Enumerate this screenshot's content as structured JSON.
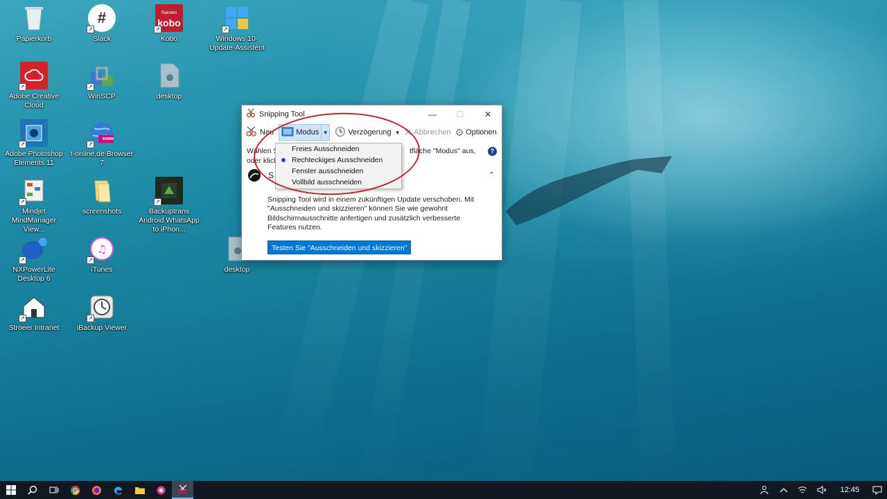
{
  "desktop": {
    "icons": [
      {
        "label": "Papierkorb",
        "icon": "recycle-bin-icon"
      },
      {
        "label": "Slack",
        "icon": "slack-icon"
      },
      {
        "label": "Kobo",
        "icon": "kobo-icon",
        "badge_text": "kobo",
        "badge_small": "Rakuten"
      },
      {
        "label": "Windows 10-Update-Assistent",
        "icon": "windows-logo-icon"
      },
      {
        "label": "Adobe Creative Cloud",
        "icon": "creative-cloud-icon"
      },
      {
        "label": "WinSCP",
        "icon": "winscp-icon"
      },
      {
        "label": "desktop",
        "icon": "file-icon"
      },
      {
        "label": "Adobe Photoshop Elements 11",
        "icon": "photoshop-elements-icon"
      },
      {
        "label": "t-online.de Browser 7",
        "icon": "globe-icon",
        "badge_text": "www"
      },
      {
        "label": "Mindjet MindManager View...",
        "icon": "mindmanager-icon"
      },
      {
        "label": "screenshots",
        "icon": "folder-icon"
      },
      {
        "label": "Backuptrans Android WhatsApp to iPhon...",
        "icon": "backuptrans-icon"
      },
      {
        "label": "NXPowerLite Desktop 6",
        "icon": "nxpowerlite-icon"
      },
      {
        "label": "iTunes",
        "icon": "itunes-icon"
      },
      {
        "label": "desktop",
        "icon": "file-icon"
      },
      {
        "label": "Stroeer Intranet",
        "icon": "home-icon"
      },
      {
        "label": "iBackup Viewer",
        "icon": "clock-icon"
      }
    ]
  },
  "window": {
    "title": "Snipping Tool",
    "controls": {
      "minimize": "—",
      "maximize": "☐",
      "close": "✕"
    },
    "toolbar": {
      "new_label": "Neu",
      "mode_label": "Modus",
      "delay_label": "Verzögerung",
      "cancel_label": "Abbrechen",
      "options_label": "Optionen"
    },
    "info": {
      "line1_start": "Wählen S",
      "line1_end": "tfläche \"Modus\" aus,",
      "line2_start": "oder klick",
      "help": "?"
    },
    "notice": {
      "title_initial": "S",
      "collapse": "⌃",
      "body": "Snipping Tool wird in einem zukünftigen Update verschoben. Mit \"Ausschneiden und skizzieren\" können Sie wie gewohnt Bildschirmausschnitte anfertigen und zusätzlich verbesserte Features nutzen.",
      "button_label": "Testen Sie \"Ausschneiden und skizzieren\""
    }
  },
  "mode_dropdown": {
    "items": [
      {
        "label": "Freies Ausschneiden",
        "selected": false
      },
      {
        "label": "Rechteckiges Ausschneiden",
        "selected": true
      },
      {
        "label": "Fenster ausschneiden",
        "selected": false
      },
      {
        "label": "Vollbild ausschneiden",
        "selected": false
      }
    ]
  },
  "taskbar": {
    "clock": "12:45",
    "colors": {
      "background": "#101820",
      "accent": "#0078d7"
    }
  }
}
